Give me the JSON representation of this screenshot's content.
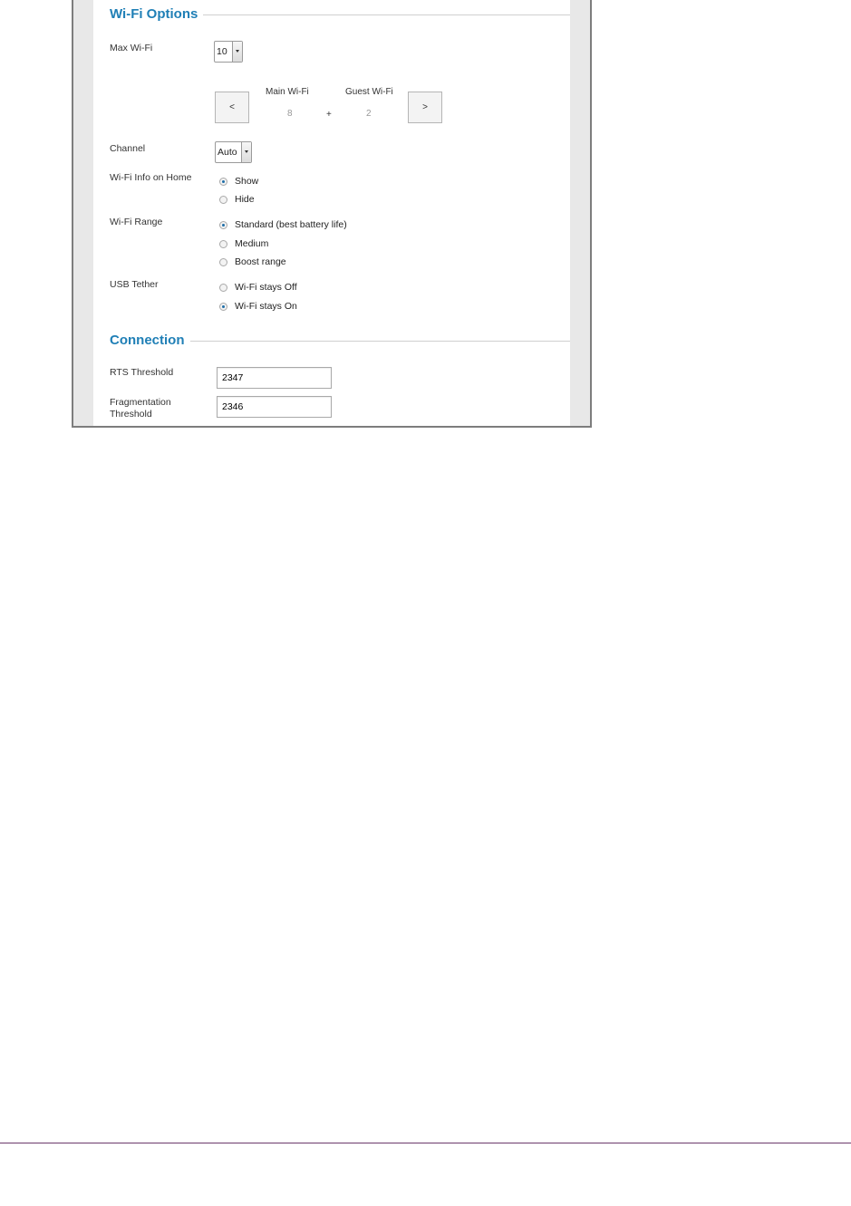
{
  "wifi_options": {
    "title": "Wi-Fi Options",
    "max_wifi": {
      "label": "Max Wi-Fi",
      "value": "10"
    },
    "split": {
      "prev_label": "<",
      "next_label": ">",
      "main_label": "Main Wi-Fi",
      "main_value": "8",
      "plus": "+",
      "guest_label": "Guest Wi-Fi",
      "guest_value": "2"
    },
    "channel": {
      "label": "Channel",
      "value": "Auto"
    },
    "info_on_home": {
      "label": "Wi-Fi Info on Home",
      "options": [
        {
          "label": "Show",
          "selected": true
        },
        {
          "label": "Hide",
          "selected": false
        }
      ]
    },
    "range": {
      "label": "Wi-Fi Range",
      "options": [
        {
          "label": "Standard (best battery life)",
          "selected": true
        },
        {
          "label": "Medium",
          "selected": false
        },
        {
          "label": "Boost range",
          "selected": false
        }
      ]
    },
    "usb_tether": {
      "label": "USB Tether",
      "options": [
        {
          "label": "Wi-Fi stays Off",
          "selected": false
        },
        {
          "label": "Wi-Fi stays On",
          "selected": true
        }
      ]
    }
  },
  "connection": {
    "title": "Connection",
    "rts": {
      "label": "RTS Threshold",
      "value": "2347"
    },
    "fragmentation": {
      "label_line1": "Fragmentation",
      "label_line2": "Threshold",
      "value": "2346"
    }
  },
  "colors": {
    "section_title": "#1f7fb6",
    "radio_selected": "#1f6ea8",
    "footer_rule": "#6b3a6b"
  }
}
